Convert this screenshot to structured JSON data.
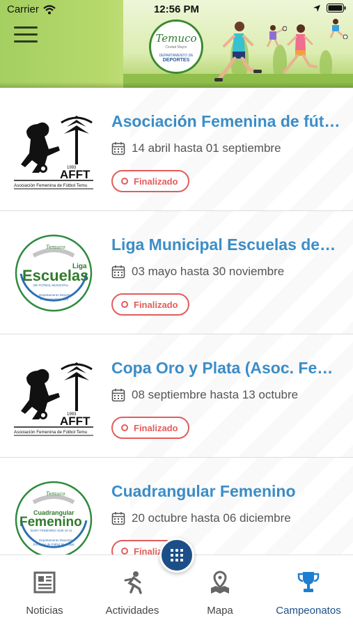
{
  "status_bar": {
    "carrier": "Carrier",
    "time": "12:56 PM"
  },
  "header": {
    "logo": {
      "brand": "Temuco",
      "tagline": "Ciudad Mayor",
      "department": "DEPARTAMENTO DE",
      "sports": "DEPORTES"
    },
    "colors": {
      "primary": "#a4cf61",
      "accent": "#3b8a2e"
    }
  },
  "championships": [
    {
      "title": "Asociación Femenina de fútbol Temuco",
      "dates": "14 abril hasta 01 septiembre",
      "status": "Finalizado",
      "logo": {
        "kind": "afft",
        "year": "1993",
        "acronym": "AFFT",
        "caption": "Asociación Femenina de Fútbol Temu"
      }
    },
    {
      "title": "Liga Municipal Escuelas deportivas",
      "dates": "03 mayo hasta 30 noviembre",
      "status": "Finalizado",
      "logo": {
        "kind": "escuelas",
        "top": "Liga",
        "word": "Escuelas",
        "sub": "DE FÚTBOL MUNICIPAL",
        "footer1": "Departamento Deportes",
        "footer2": "Programa Deportivo"
      }
    },
    {
      "title": "Copa Oro y Plata (Asoc. Femenina)",
      "dates": "08 septiembre hasta 13 octubre",
      "status": "Finalizado",
      "logo": {
        "kind": "afft",
        "year": "1993",
        "acronym": "AFFT",
        "caption": "Asociación Femenina de Fútbol Temu"
      }
    },
    {
      "title": "Cuadrangular Femenino",
      "dates": "20 octubre hasta 06 diciembre",
      "status": "Finalizado",
      "logo": {
        "kind": "femenino",
        "top": "Cuadrangular",
        "word": "Femenino",
        "sub": "BABY FEMENINO SUB 10-11",
        "footer1": "Departamento Deportes",
        "footer2": "Escuelas de Fútbol Municipal"
      }
    }
  ],
  "tab_bar": {
    "tabs": [
      {
        "label": "Noticias",
        "icon": "newspaper-icon"
      },
      {
        "label": "Actividades",
        "icon": "runner-icon"
      },
      {
        "label": "Mapa",
        "icon": "map-pin-icon"
      },
      {
        "label": "Campeonatos",
        "icon": "trophy-icon",
        "active": true
      }
    ],
    "fab_icon": "grid-icon",
    "colors": {
      "active": "#1c4f87",
      "inactive": "#6b6b6b"
    }
  },
  "colors": {
    "title": "#3b8ec9",
    "status_finalizado": "#e45b5b"
  }
}
